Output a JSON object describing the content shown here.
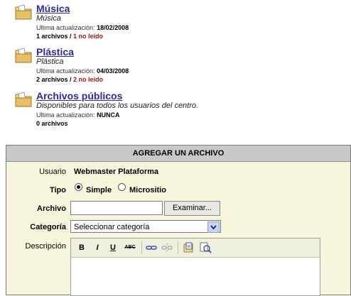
{
  "folders": [
    {
      "title": "Música",
      "description": "Música",
      "updated_label": "Ultima actualización:",
      "updated_value": "18/02/2008",
      "count": "1 archivos",
      "unread": "1 no leído"
    },
    {
      "title": "Plástica",
      "description": "Plástica",
      "updated_label": "Ultima actualización:",
      "updated_value": "04/03/2008",
      "count": "2 archivos",
      "unread": "2 no leído"
    },
    {
      "title": "Archivos públicos",
      "description": "Disponibles para todos los usuarios del centro.",
      "updated_label": "Ultima actualización:",
      "updated_value": "NUNCA",
      "count": "0 archivos",
      "unread": ""
    }
  ],
  "upload": {
    "header": "AGREGAR UN ARCHIVO",
    "user_label": "Usuario",
    "user_value": "Webmaster Plataforma",
    "type_label": "Tipo",
    "type_options": [
      "Simple",
      "Micrositio"
    ],
    "type_selected": "Simple",
    "file_label": "Archivo",
    "browse_label": "Examinar...",
    "category_label": "Categoría",
    "category_value": "Seleccionar categoría",
    "description_label": "Descripción",
    "toolbar": {
      "bold": "B",
      "italic": "I",
      "underline": "U",
      "strike": "ABC"
    }
  }
}
